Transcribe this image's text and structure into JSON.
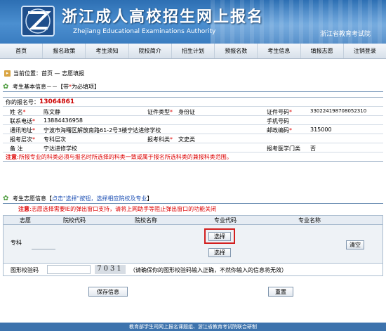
{
  "header": {
    "title": "浙江成人高校招生网上报名",
    "subtitle": "Zhejiang Educational Examinations Authority",
    "org": "浙江省教育考试院"
  },
  "nav": [
    "首页",
    "报名政策",
    "考生须知",
    "院校简介",
    "招生计划",
    "预报名数",
    "考生信息",
    "填报志愿",
    "注销登录"
  ],
  "breadcrumb": "当前位置：首页 — 志愿填报",
  "basic": {
    "title": "考生基本信息－－【带",
    "star": "*",
    "title_end": "为必填项】",
    "reg_label": "你的报名号：",
    "reg_no": "13064861",
    "name_label": "姓 名",
    "name": "陈文静",
    "id_type_label": "证件类型",
    "id_type": "身份证",
    "id_no_label": "证件号码",
    "id_no": "330224198708052310",
    "phone_label": "联系电话",
    "phone": "13884436958",
    "mobile_label": "手机号码",
    "mobile": "",
    "addr_label": "通讯地址",
    "addr": "宁波市海曙区解放南路61-2号3楼宁达进修学校",
    "zip_label": "邮政编码",
    "zip": "315000",
    "level_label": "报考层次",
    "level": "专科层次",
    "subject_label": "报考科类",
    "subject": "文史类",
    "note_label": "备 注",
    "note": "宁达进修学校",
    "med_label": "报考医学门类",
    "med": "否",
    "warning_label": "注意",
    "warning": ":所报专业的科类必须与报名时所选择的科类一致或属于报名所选科类的兼报科类范围。"
  },
  "wish": {
    "title_a": "考生志愿信息【",
    "title_b": "点击\"选择\"按钮，选择相应院校及专业",
    "title_c": "】",
    "warning_label": "注意",
    "warning": ":志愿选择需要IE的弹出窗口支持，请将上网助手等阻止弹出窗口的功能关闭",
    "col_wish": "志愿",
    "col_school_code": "院校代码",
    "col_school_name": "院校名称",
    "col_major_code": "专业代码",
    "col_major_name": "专业名称",
    "row_label": "专科",
    "select1": "选择",
    "select2": "选择",
    "clear": "清空",
    "captcha_label": "图形校验码",
    "captcha_value": "",
    "captcha_image": "7031",
    "captcha_hint": "（请确保你的图形校验码输入正确，不然你输入的信息将无效）",
    "save": "保存信息",
    "reset": "重置"
  },
  "footer": "教育部学生司网上报名课题组、浙江省教育考试院联合研制",
  "colors": {
    "accent": "#2d6fb3",
    "warning": "#dd0000",
    "reg_no": "#cc0000",
    "footer": "#3d73ad"
  }
}
